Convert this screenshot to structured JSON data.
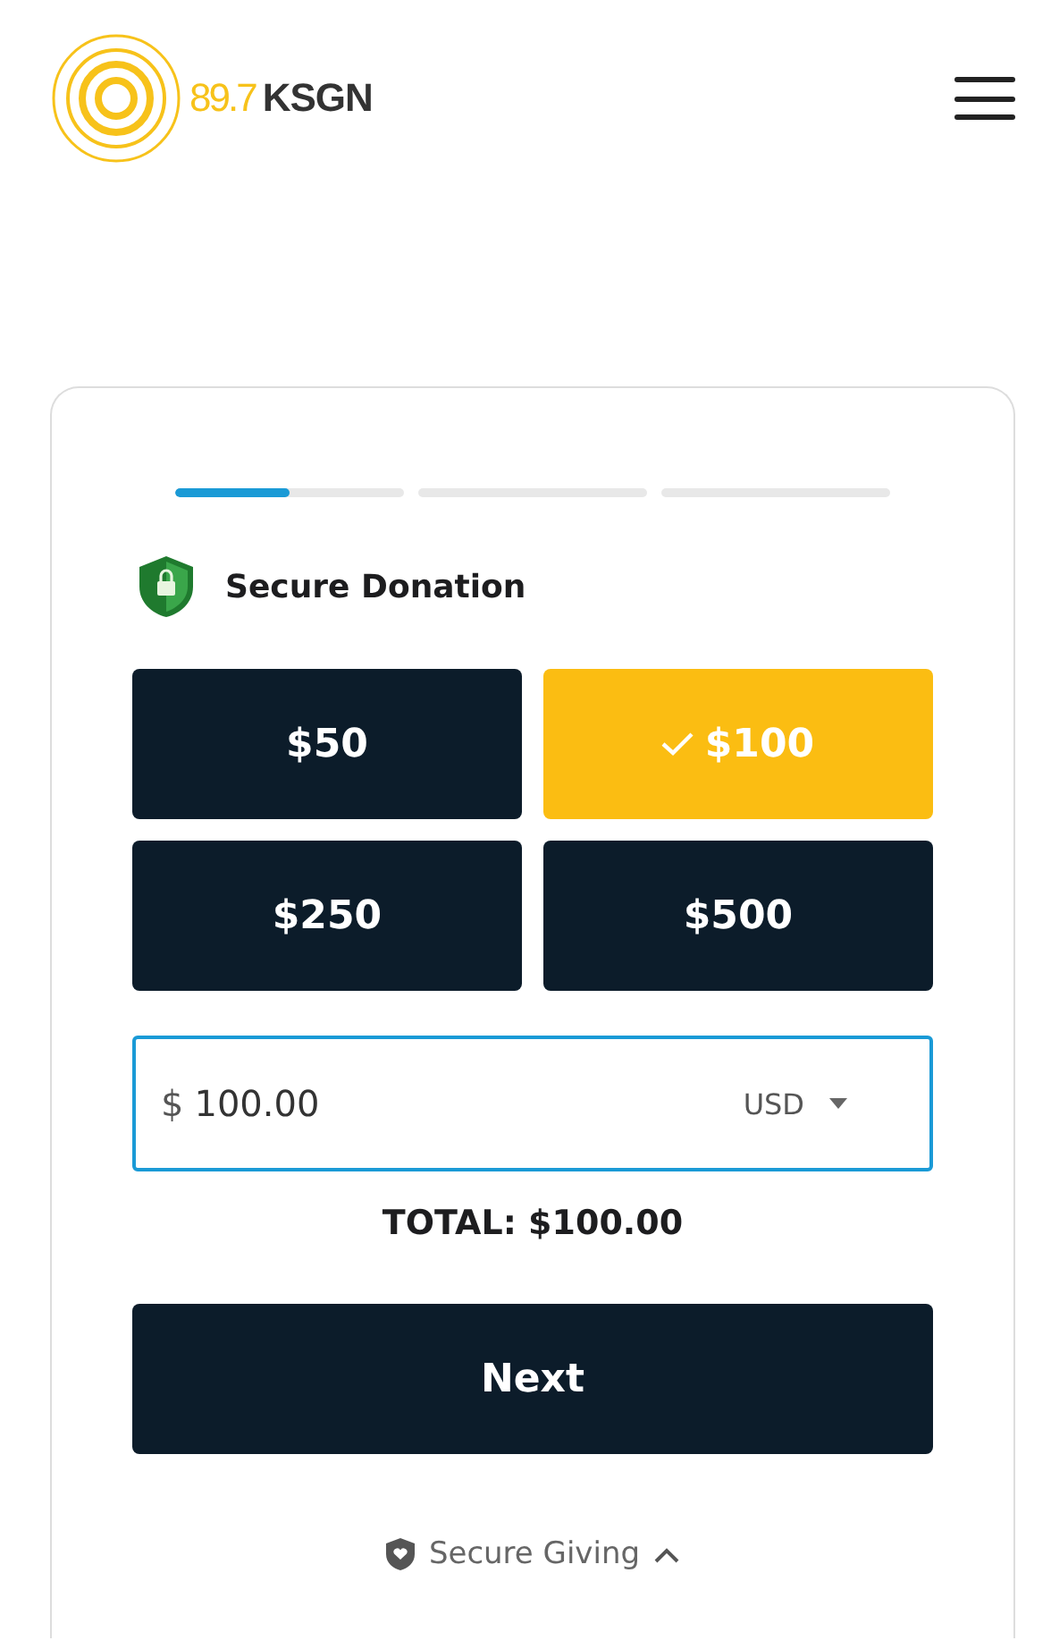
{
  "header": {
    "logo_frequency": "89.7",
    "logo_call_sign": "KSGN"
  },
  "progress": [
    {
      "level": 0.5
    },
    {
      "level": 0
    },
    {
      "level": 0
    }
  ],
  "title": "Secure Donation",
  "amounts": [
    {
      "label": "$50",
      "selected": false
    },
    {
      "label": "$100",
      "selected": true
    },
    {
      "label": "$250",
      "selected": false
    },
    {
      "label": "$500",
      "selected": false
    }
  ],
  "amount_field": {
    "currency_symbol": "$",
    "value": "100.00",
    "currency": "USD"
  },
  "total": "TOTAL: $100.00",
  "next_button": "Next",
  "footer": {
    "label": "Secure Giving",
    "expanded": false
  }
}
